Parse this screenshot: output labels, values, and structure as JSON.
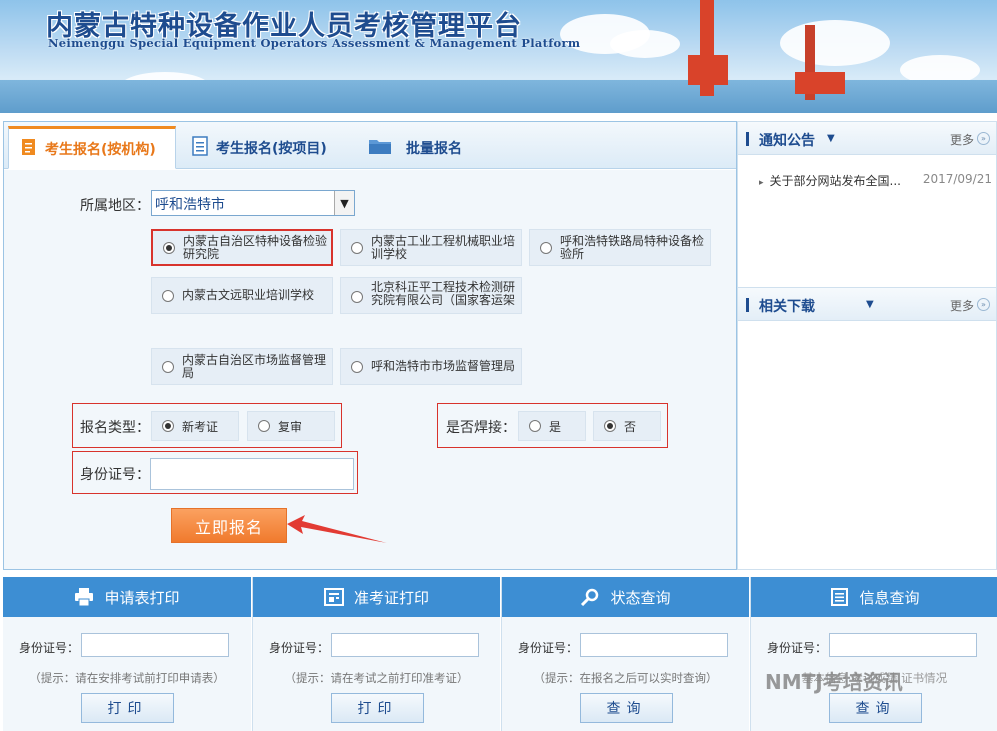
{
  "banner": {
    "title": "内蒙古特种设备作业人员考核管理平台",
    "subtitle": "Neimenggu Special Equipment Operators Assessment & Management Platform"
  },
  "tabs": [
    {
      "label": "考生报名(按机构)",
      "icon": "pen-doc-icon",
      "active": true
    },
    {
      "label": "考生报名(按项目)",
      "icon": "document-icon",
      "active": false
    },
    {
      "label": "批量报名",
      "icon": "folder-icon",
      "active": false
    }
  ],
  "form": {
    "region_label": "所属地区：",
    "region_value": "呼和浩特市",
    "institutions": [
      {
        "label": "内蒙古自治区特种设备检验研究院",
        "selected": true
      },
      {
        "label": "内蒙古工业工程机械职业培训学校",
        "selected": false
      },
      {
        "label": "呼和浩特铁路局特种设备检验所",
        "selected": false
      },
      {
        "label": "内蒙古文远职业培训学校",
        "selected": false
      },
      {
        "label": "北京科正平工程技术检测研究院有限公司（国家客运架",
        "selected": false
      },
      {
        "label": "内蒙古自治区市场监督管理局",
        "selected": false
      },
      {
        "label": "呼和浩特市市场监督管理局",
        "selected": false
      }
    ],
    "type_label": "报名类型：",
    "type_options": [
      {
        "label": "新考证",
        "selected": true
      },
      {
        "label": "复审",
        "selected": false
      }
    ],
    "weld_label": "是否焊接：",
    "weld_options": [
      {
        "label": "是",
        "selected": false
      },
      {
        "label": "否",
        "selected": true
      }
    ],
    "id_label": "身份证号：",
    "id_value": "",
    "submit_label": "立即报名"
  },
  "notice": {
    "title": "通知公告",
    "more": "更多",
    "items": [
      {
        "text": "关于部分网站发布全国...",
        "date": "2017/09/21"
      }
    ]
  },
  "downloads": {
    "title": "相关下载",
    "more": "更多"
  },
  "bottom": [
    {
      "title": "申请表打印",
      "icon": "printer-icon",
      "field_label": "身份证号：",
      "hint": "（提示：请在安排考试前打印申请表）",
      "button": "打印"
    },
    {
      "title": "准考证打印",
      "icon": "card-icon",
      "field_label": "身份证号：",
      "hint": "（提示：请在考试之前打印准考证）",
      "button": "打印"
    },
    {
      "title": "状态查询",
      "icon": "magnifier-icon",
      "field_label": "身份证号：",
      "hint": "（提示：在报名之后可以实时查询）",
      "button": "查询"
    },
    {
      "title": "信息查询",
      "icon": "list-icon",
      "field_label": "身份证号：",
      "hint": "基本信息  考试成绩  证书情况",
      "button": "查询"
    }
  ],
  "watermark": "NMTJ考培资讯",
  "colors": {
    "accent": "#f08a1f",
    "brand": "#1e4c8f",
    "header_blue": "#3d8ed3",
    "highlight_red": "#d8332c"
  }
}
